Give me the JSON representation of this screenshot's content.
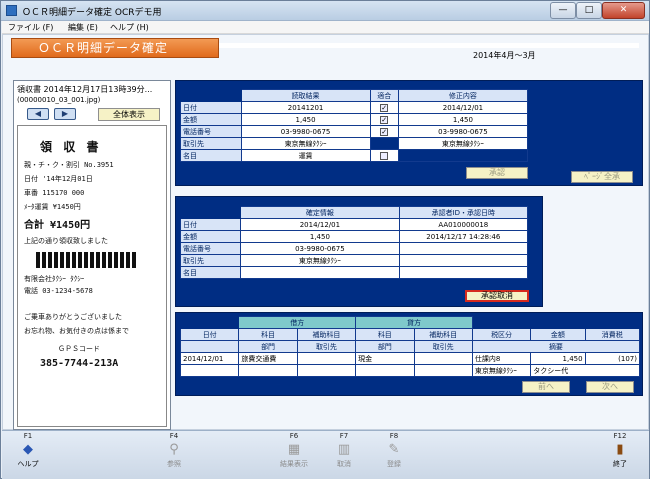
{
  "window": {
    "title": "ＯＣＲ明細データ確定 OCRデモ用",
    "min_glyph": "—",
    "max_glyph": "□",
    "close_glyph": "✕"
  },
  "menu": [
    "ファイル (F)",
    "編集 (E)",
    "ヘルプ (H)"
  ],
  "banner": {
    "title": "ＯＣＲ明細データ確定",
    "period": "2014年4月～3月"
  },
  "viewer": {
    "title": "領収書 2014年12月17日13時39分...",
    "filename": "(00000010_03_001.jpg)",
    "full_view_label": "全体表示",
    "prev_glyph": "◀",
    "next_glyph": "▶"
  },
  "receipt_lines": [
    "領  収  書",
    "親・チ・ク・割引 No.3951",
    "日付 '14年12月01日",
    "車番    115170      000",
    "ﾒｰﾀ運賃           ¥1450円",
    "合計    ¥1450円",
    "上記の通り領収致しました",
    "有限会社ﾀｸｼｰ ﾀｸｼｰ",
    "電話 03-1234-5678",
    "ご乗車ありがとうございました",
    "お忘れ物、お気付きの点は係まで",
    "ＧＰＳコード",
    "385-7744-213A"
  ],
  "ocr": {
    "headers": [
      "読取結果",
      "適合",
      "修正内容"
    ],
    "rows": [
      {
        "label": "日付",
        "result": "20141201",
        "fit": "✓",
        "corrected": "2014/12/01"
      },
      {
        "label": "金額",
        "result": "1,450",
        "fit": "✓",
        "corrected": "1,450"
      },
      {
        "label": "電話番号",
        "result": "03-9980-0675",
        "fit": "✓",
        "corrected": "03-9980-0675"
      },
      {
        "label": "取引先",
        "result": "東京無線ﾀｸｼｰ",
        "fit": "",
        "corrected": "東京無線ﾀｸｼｰ"
      },
      {
        "label": "名目",
        "result": "運賃",
        "fit": "",
        "corrected": ""
      }
    ],
    "approve_label": "承認",
    "right_btn_label": "ﾍﾟｰｼﾞ全承"
  },
  "confirm": {
    "headers": [
      "確定情報",
      "承認者ID・承認日時"
    ],
    "rows": [
      {
        "label": "日付",
        "value": "2014/12/01",
        "extra": "AA010000018"
      },
      {
        "label": "金額",
        "value": "1,450",
        "extra": "2014/12/17 14:28:46"
      },
      {
        "label": "電話番号",
        "value": "03-9980-0675",
        "extra": ""
      },
      {
        "label": "取引先",
        "value": "東京無線ﾀｸｼｰ",
        "extra": ""
      },
      {
        "label": "名目",
        "value": "",
        "extra": ""
      }
    ],
    "cancel_label": "承認取消"
  },
  "journal": {
    "group_debit": "借方",
    "group_credit": "貸方",
    "h_date": "日付",
    "h_subject": "科目",
    "h_sub": "補助科目",
    "h_tax": "税区分",
    "h_amount": "金額",
    "h_vat": "消費税",
    "h_dept": "部門",
    "h_partner": "取引先",
    "h_summary": "摘要",
    "date": "2014/12/01",
    "debit_subject": "旅費交通費",
    "credit_subject": "現金",
    "tax": "仕課内8",
    "amount": "1,450",
    "vat": "(107)",
    "summary_partner": "東京無線ﾀｸｼｰ",
    "summary": "タクシー代",
    "prev_label": "前へ",
    "next_label": "次へ"
  },
  "fkeys": [
    {
      "key": "F1",
      "label": "ヘルプ",
      "icon": "help-book-icon"
    },
    {
      "key": "F4",
      "label": "参照",
      "icon": "magnifier-icon"
    },
    {
      "key": "F6",
      "label": "結果表示",
      "icon": "calculator-icon"
    },
    {
      "key": "F7",
      "label": "取消",
      "icon": "trash-icon"
    },
    {
      "key": "F8",
      "label": "登録",
      "icon": "register-icon"
    },
    {
      "key": "F12",
      "label": "終了",
      "icon": "exit-door-icon"
    }
  ]
}
